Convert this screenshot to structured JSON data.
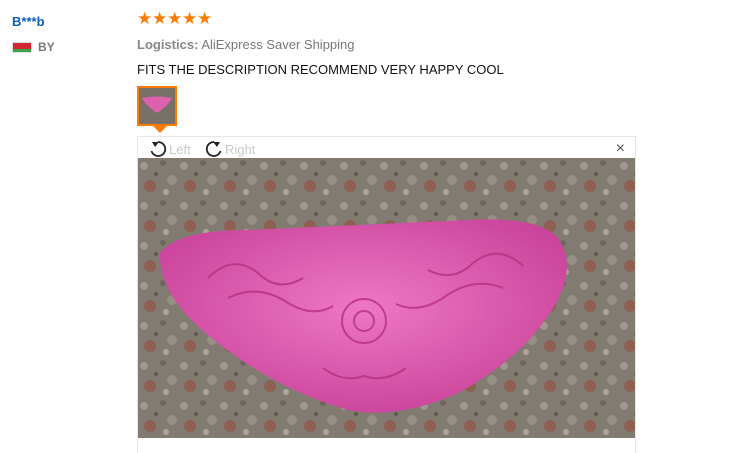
{
  "review": {
    "user": "B***b",
    "country": "BY",
    "rating": 5,
    "logistics_label": "Logistics:",
    "logistics_value": "AliExpress Saver Shipping",
    "text": "FITS THE DESCRIPTION RECOMMEND VERY HAPPY COOL"
  },
  "viewer": {
    "rotate_left_label": "Left",
    "rotate_right_label": "Right",
    "close_symbol": "×"
  },
  "colors": {
    "accent": "#ff7a00",
    "username": "#0b5fb8",
    "mold_pink": "#e060b0"
  },
  "icons": [
    "star-icon",
    "flag-icon",
    "rotate-left-icon",
    "rotate-right-icon",
    "close-icon"
  ]
}
